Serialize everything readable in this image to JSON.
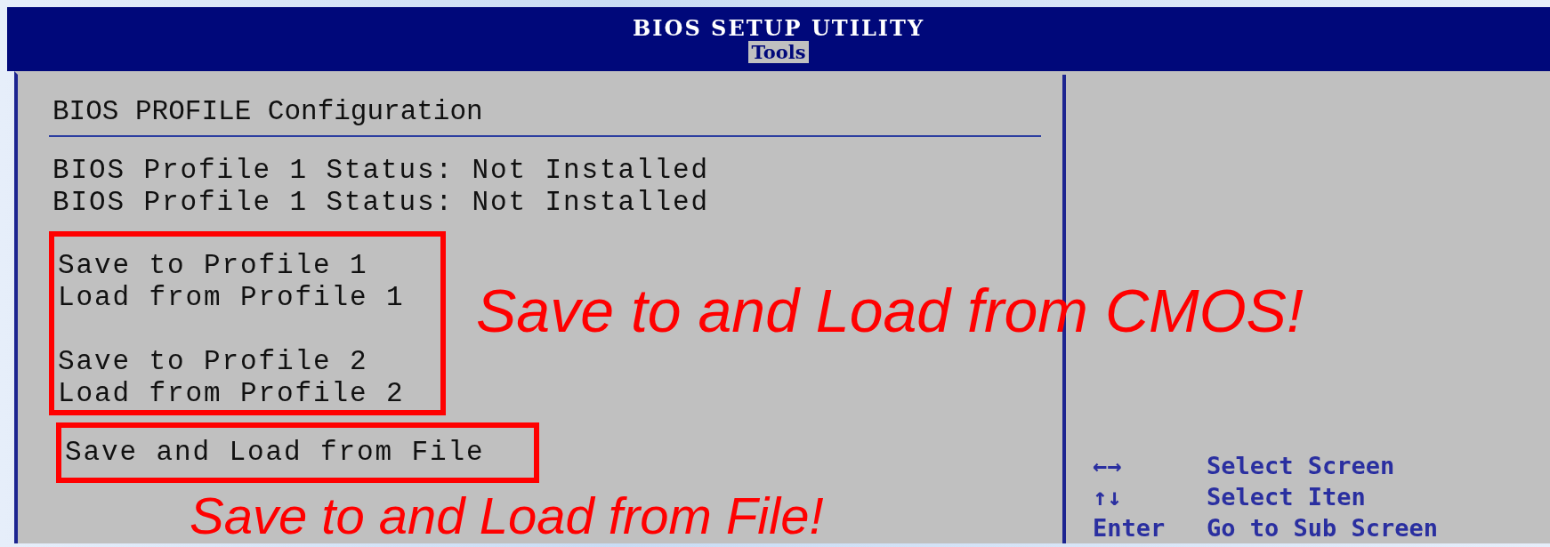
{
  "header": {
    "title": "BIOS SETUP UTILITY",
    "tabs": [
      {
        "label": "Tools",
        "selected": true
      }
    ]
  },
  "config": {
    "heading": "BIOS PROFILE Configuration",
    "status_lines": [
      "BIOS Profile 1 Status: Not Installed",
      "BIOS Profile 1 Status: Not Installed"
    ],
    "groups": [
      {
        "boxed": true,
        "sections": [
          [
            "Save to Profile 1",
            "Load from Profile 1"
          ],
          [
            "Save to Profile 2",
            "Load from Profile 2"
          ]
        ]
      },
      {
        "boxed": true,
        "sections": [
          [
            "Save and Load from File"
          ]
        ]
      }
    ]
  },
  "help": [
    {
      "key": "←→",
      "action": "Select Screen"
    },
    {
      "key": "↑↓",
      "action": "Select Iten"
    },
    {
      "key": "Enter",
      "action": "Go to Sub Screen"
    }
  ],
  "annotations": [
    "Save to and Load from CMOS!",
    "Save to and Load from File!"
  ]
}
